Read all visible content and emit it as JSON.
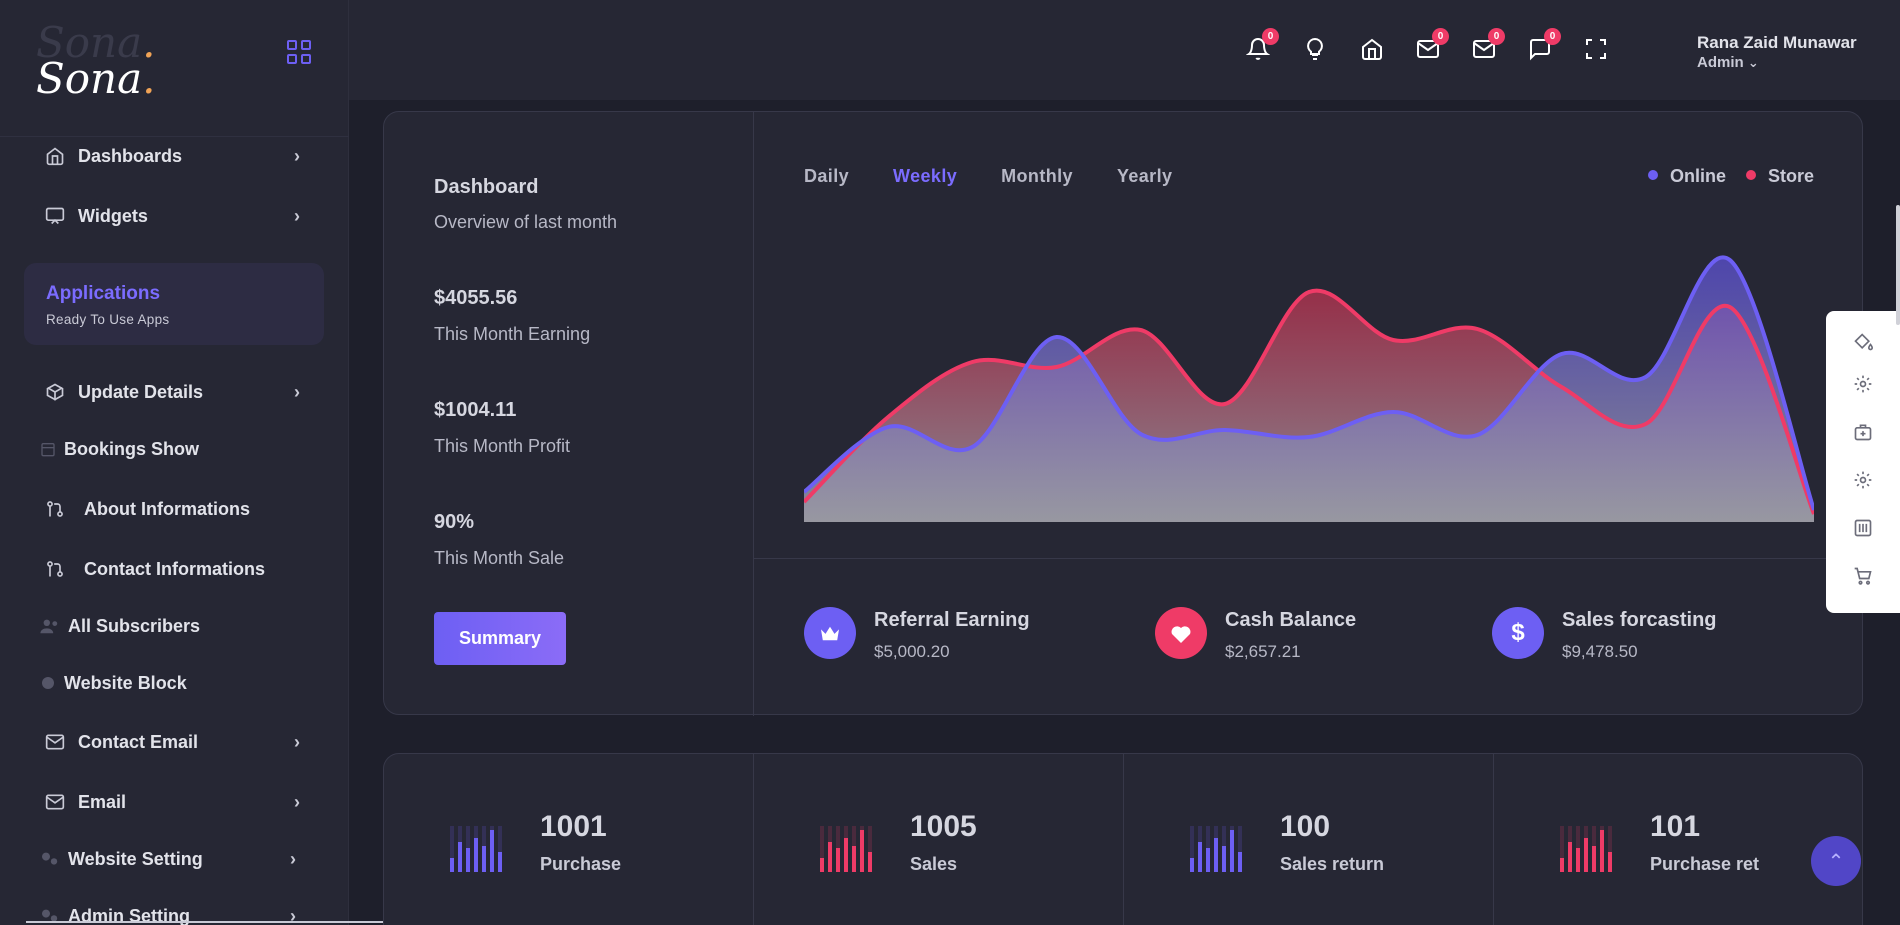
{
  "brand": {
    "logo_text": "Sona",
    "logo_dot": "."
  },
  "sidebar": {
    "items": [
      {
        "label": "Dashboards",
        "icon": "home-icon",
        "chevron": true
      },
      {
        "label": "Widgets",
        "icon": "monitor-icon",
        "chevron": true
      },
      {
        "label": "Update Details",
        "icon": "box-icon",
        "chevron": true
      },
      {
        "label": "Bookings Show",
        "icon": "calendar-icon",
        "chevron": false
      },
      {
        "label": "About Informations",
        "icon": "git-pull-icon",
        "chevron": false
      },
      {
        "label": "Contact Informations",
        "icon": "git-pull-icon",
        "chevron": false
      },
      {
        "label": "All Subscribers",
        "icon": "users-icon",
        "chevron": false
      },
      {
        "label": "Website Block",
        "icon": "circle-icon",
        "chevron": false
      },
      {
        "label": "Contact Email",
        "icon": "mail-icon",
        "chevron": true
      },
      {
        "label": "Email",
        "icon": "mail-icon",
        "chevron": true
      },
      {
        "label": "Website Setting",
        "icon": "cogs-icon",
        "chevron": true
      },
      {
        "label": "Admin Setting",
        "icon": "cogs-icon",
        "chevron": true
      }
    ],
    "apps_box": {
      "title": "Applications",
      "subtitle": "Ready To Use Apps"
    }
  },
  "header": {
    "badges": [
      "0",
      "0",
      "0",
      "0"
    ],
    "user": {
      "name": "Rana Zaid Munawar",
      "role": "Admin"
    }
  },
  "overview": {
    "title": "Dashboard",
    "subtitle": "Overview of last month",
    "metrics": [
      {
        "value": "$4055.56",
        "label": "This Month Earning"
      },
      {
        "value": "$1004.11",
        "label": "This Month Profit"
      },
      {
        "value": "90%",
        "label": "This Month Sale"
      }
    ],
    "summary_button": "Summary"
  },
  "tabs": [
    {
      "label": "Daily",
      "active": false
    },
    {
      "label": "Weekly",
      "active": true
    },
    {
      "label": "Monthly",
      "active": false
    },
    {
      "label": "Yearly",
      "active": false
    }
  ],
  "legend": [
    {
      "label": "Online",
      "color": "#6d5ff3"
    },
    {
      "label": "Store",
      "color": "#ef3b67"
    }
  ],
  "chart_data": {
    "type": "area",
    "series": [
      {
        "name": "Online",
        "color": "#6d5ff3",
        "values": [
          30,
          95,
          75,
          185,
          88,
          92,
          85,
          110,
          87,
          168,
          145,
          262,
          12
        ]
      },
      {
        "name": "Store",
        "color": "#ef3b67",
        "values": [
          20,
          105,
          160,
          155,
          192,
          118,
          230,
          182,
          193,
          135,
          98,
          215,
          8
        ]
      }
    ],
    "legend_position": "top-right",
    "grid": false
  },
  "stats": [
    {
      "title": "Referral Earning",
      "value": "$5,000.20",
      "icon": "crown-icon",
      "color": "#6d5ff3"
    },
    {
      "title": "Cash Balance",
      "value": "$2,657.21",
      "icon": "heart-icon",
      "color": "#ef3b67"
    },
    {
      "title": "Sales forcasting",
      "value": "$9,478.50",
      "icon": "dollar-icon",
      "color": "#6d5ff3"
    }
  ],
  "kpis": [
    {
      "number": "1001",
      "label": "Purchase",
      "color": "#6d5ff3"
    },
    {
      "number": "1005",
      "label": "Sales",
      "color": "#ef3b67"
    },
    {
      "number": "100",
      "label": "Sales return",
      "color": "#6d5ff3"
    },
    {
      "number": "101",
      "label": "Purchase ret",
      "color": "#ef3b67"
    }
  ]
}
